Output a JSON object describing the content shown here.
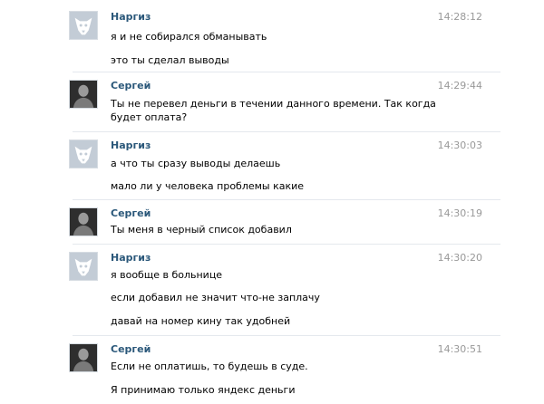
{
  "conversation": {
    "blocks": [
      {
        "author": "Наргиз",
        "avatar": "dog-avatar-icon",
        "time": "14:28:12",
        "lines": [
          "я и не собирался обманывать",
          "это ты сделал выводы"
        ]
      },
      {
        "author": "Сергей",
        "avatar": "user-photo-avatar",
        "time": "14:29:44",
        "lines": [
          "Ты не перевел деньги в течении данного времени. Так когда будет оплата?"
        ]
      },
      {
        "author": "Наргиз",
        "avatar": "dog-avatar-icon",
        "time": "14:30:03",
        "lines": [
          "а что ты сразу выводы делаешь",
          "мало ли у человека проблемы какие"
        ]
      },
      {
        "author": "Сергей",
        "avatar": "user-photo-avatar",
        "time": "14:30:19",
        "lines": [
          "Ты меня в черный список добавил"
        ]
      },
      {
        "author": "Наргиз",
        "avatar": "dog-avatar-icon",
        "time": "14:30:20",
        "lines": [
          "я вообще в больнице",
          "если добавил не значит что-не заплачу",
          "давай на номер кину так удобней"
        ]
      },
      {
        "author": "Сергей",
        "avatar": "user-photo-avatar",
        "time": "14:30:51",
        "lines": [
          "Если не оплатишь, то будешь в суде.",
          "Я принимаю только яндекс деньги"
        ]
      }
    ]
  },
  "colors": {
    "author_link": "#2b587a",
    "timestamp": "#999999",
    "text": "#000000"
  }
}
